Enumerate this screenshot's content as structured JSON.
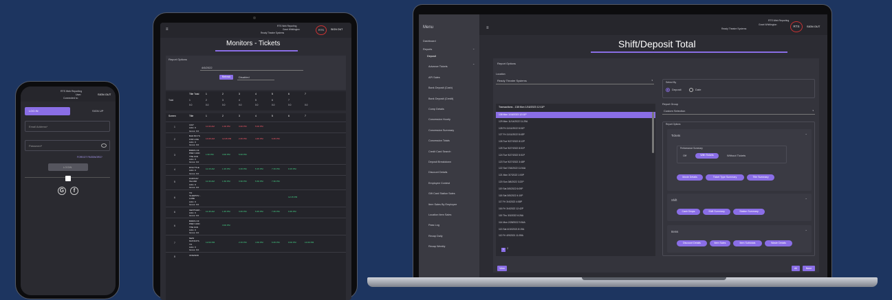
{
  "app": {
    "brand": "RTS Web Reporting",
    "user_label": "User:",
    "user_name": "Grant Whittington",
    "connected_label": "Connected to:",
    "connected_to": "Ready Theatre Systems",
    "logo": "RTS",
    "sign_out": "SIGN OUT"
  },
  "phone": {
    "app": "RTS Web Reporting",
    "user": "User:",
    "connected": "Connected to:",
    "sign_out": "SIGN OUT",
    "tab_login": "LOG IN",
    "tab_signup": "SIGN UP",
    "email_placeholder": "Email Address*",
    "password_placeholder": "Password*",
    "forgot": "FORGOT PASSWORD?",
    "login_button": "LOGIN",
    "social": [
      "google-icon",
      "facebook-icon"
    ]
  },
  "tablet": {
    "title": "Monitors - Tickets",
    "report_options": "Report Options",
    "date": "4/6/2022",
    "refresh": "Refresh",
    "disabled": "Disabled",
    "totals_header": [
      "Title Total",
      "1",
      "2",
      "3",
      "4",
      "5",
      "6",
      "7"
    ],
    "totals_row": [
      "Total",
      "1",
      "2",
      "3",
      "4",
      "5",
      "6",
      "7"
    ],
    "totals_vals": [
      "0.0",
      "0.0",
      "0.0",
      "0.0",
      "0.0",
      "0.0",
      "0.0",
      "0.0"
    ],
    "grid_header": [
      "Screen",
      "Title",
      "1",
      "2",
      "3",
      "4",
      "5",
      "6",
      "7"
    ],
    "rows": [
      {
        "screen": "1",
        "title": "1917\nAdm: 0\nGross: 0.0",
        "cells": [
          "11:00 AM",
          "1:00 PM",
          "3:00 PM",
          "5:00 PM",
          "",
          "",
          ""
        ],
        "color": "red"
      },
      {
        "screen": "2",
        "title": "BAD BOYS\nFOR LIFE\nAdm: 0\nGross: 0.0",
        "cells": [
          "10:45 AM",
          "12:45 PM",
          "2:45 PM",
          "4:45 PM",
          "6:45 PM",
          "",
          ""
        ],
        "color": "red"
      },
      {
        "screen": "3",
        "title": "BIRDS OF\nPREY AND\nTHE FAN\nAdm: 0\nGross: 0.0",
        "cells": [
          "1:00 PM",
          "3:00 PM",
          "5:00 PM",
          "",
          "",
          "",
          ""
        ],
        "color": "green"
      },
      {
        "screen": "4",
        "title": "DOLITTLE\nAdm: 0\nGross: 0.0",
        "cells": [
          "11:15 AM",
          "1:15 PM",
          "3:15 PM",
          "5:15 PM",
          "7:15 PM",
          "9:15 PM",
          ""
        ],
        "color": "green"
      },
      {
        "screen": "5",
        "title": "FANTASY\nISLAND\nAdm: 0\nGross: 0.0",
        "cells": [
          "11:30 AM",
          "1:30 PM",
          "3:30 PM",
          "5:30 PM",
          "7:30 PM",
          "",
          ""
        ],
        "color": "green"
      },
      {
        "screen": "6",
        "title": "TO\nSLEEPOV...\nLANE\nAdm: 0\nGross: 0.0",
        "cells": [
          "",
          "",
          "",
          "",
          "",
          "12:15 PM",
          ""
        ],
        "color": "green"
      },
      {
        "screen": "6",
        "title": "GENTLEM...\nAdm: 0\nGross: 0.0",
        "cells": [
          "11:45 AM",
          "1:45 PM",
          "3:45 PM",
          "5:45 PM",
          "7:45 PM",
          "9:45 PM",
          ""
        ],
        "color": "green"
      },
      {
        "screen": "6",
        "title": "BIRDS OF\nPREY AND\nTHE FAN\nAdm: 0\nGross: 0.0",
        "cells": [
          "",
          "3:00 PM",
          "",
          "",
          "",
          "",
          ""
        ],
        "color": "green"
      },
      {
        "screen": "7",
        "title": "NEW\nMUTANTS\nTO\nAdm: 0\nGross: 0.0",
        "cells": [
          "12:00 PM",
          "",
          "2:15 PM",
          "4:30 PM",
          "6:45 PM",
          "9:00 PM",
          "10:30 PM"
        ],
        "color": "green"
      },
      {
        "screen": "8",
        "title": "ONWARD",
        "cells": [
          "",
          "",
          "",
          "",
          "",
          "",
          ""
        ],
        "color": "green"
      }
    ]
  },
  "laptop": {
    "menu_title": "Menu",
    "title": "Shift/Deposit Total",
    "sidebar": [
      "Dashboard",
      "Reports",
      "Deposit",
      "Advance Tickets",
      "API Sales",
      "Bank Deposit (Cash)",
      "Bank Deposit (Credit)",
      "Comp Details",
      "Concession Hourly",
      "Concession Summary",
      "Concession Totals",
      "Credit Card Search",
      "Deposit Breakdown",
      "Discount Details",
      "Employee Contest",
      "Gift Card Station Sales",
      "Item Sales By Employee",
      "Location Item Sales",
      "Pass Log",
      "Recap Daily",
      "Recap Weekly"
    ],
    "report_options": "Report Options",
    "location_label": "Location",
    "location_value": "Ready Theatre Systems",
    "transactions_header": "Transactions - 138 Mon 1/16/2023 12:11P",
    "transactions": [
      "138 Mon 1/16/2023 12:11P",
      "129 Mon 11/14/2022 11:29A",
      "128 Fri 11/11/2022 8:01P",
      "127 Fri 11/11/2022 8:43P",
      "126 Tue 9/27/2022 8:12P",
      "125 Tue 9/27/2022 8:01P",
      "124 Tue 9/27/2022 5:01P",
      "123 Tue 9/27/2022 3:48P",
      "122 Sat 7/16/2022 11:54A",
      "121 Mon 3/7/2022 1:00P",
      "120 Sun 3/6/2022 3:22P",
      "119 Sat 3/5/2022 6:09P",
      "118 Sat 3/5/2022 4:10P",
      "117 Fri 3/4/2022 4:58P",
      "116 Fri 3/4/2022 12:42P",
      "115 Thu 3/3/2022 6:26A",
      "114 Mon 2/28/2022 9:54A",
      "113 Sat 4/10/2021 8:19A",
      "112 Fri 4/9/2021 11:59A"
    ],
    "pages": [
      "1",
      "2"
    ],
    "view": "View",
    "select_by": "Select By",
    "select_options": [
      "Deposit",
      "Date"
    ],
    "report_group_label": "Report Group",
    "report_group_value": "Custom Selection",
    "report_options2": "Report Options",
    "tickets": "Tickets",
    "perf_summary": "Performance Summary",
    "perf_options": [
      "Off",
      "With Tickets",
      "Without Tickets"
    ],
    "ticket_buttons": [
      "Movie Details",
      "Ticket Type Summary",
      "Title Summary"
    ],
    "shift": "Shift",
    "shift_buttons": [
      "Cash Drops",
      "Shift Summary",
      "Station Summary"
    ],
    "items": "Items",
    "items_buttons": [
      "Discount Details",
      "Item Sales",
      "Item Subtotals",
      "Waste Details"
    ],
    "all": "All",
    "none": "None"
  }
}
